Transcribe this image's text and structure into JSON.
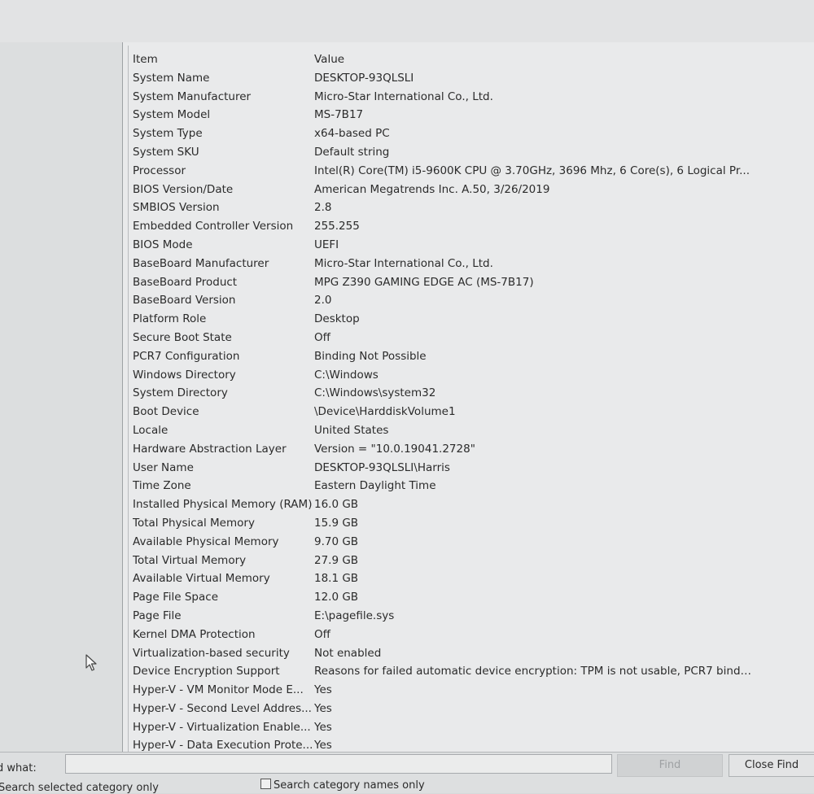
{
  "columns": {
    "item": "Item",
    "value": "Value"
  },
  "rows": [
    {
      "item": "System Name",
      "value": "DESKTOP-93QLSLI"
    },
    {
      "item": "System Manufacturer",
      "value": "Micro-Star International Co., Ltd."
    },
    {
      "item": "System Model",
      "value": "MS-7B17"
    },
    {
      "item": "System Type",
      "value": "x64-based PC"
    },
    {
      "item": "System SKU",
      "value": "Default string"
    },
    {
      "item": "Processor",
      "value": "Intel(R) Core(TM) i5-9600K CPU @ 3.70GHz, 3696 Mhz, 6 Core(s), 6 Logical Pr..."
    },
    {
      "item": "BIOS Version/Date",
      "value": "American Megatrends Inc. A.50, 3/26/2019"
    },
    {
      "item": "SMBIOS Version",
      "value": "2.8"
    },
    {
      "item": "Embedded Controller Version",
      "value": "255.255"
    },
    {
      "item": "BIOS Mode",
      "value": "UEFI"
    },
    {
      "item": "BaseBoard Manufacturer",
      "value": "Micro-Star International Co., Ltd."
    },
    {
      "item": "BaseBoard Product",
      "value": "MPG Z390 GAMING EDGE AC (MS-7B17)"
    },
    {
      "item": "BaseBoard Version",
      "value": "2.0"
    },
    {
      "item": "Platform Role",
      "value": "Desktop"
    },
    {
      "item": "Secure Boot State",
      "value": "Off"
    },
    {
      "item": "PCR7 Configuration",
      "value": "Binding Not Possible"
    },
    {
      "item": "Windows Directory",
      "value": "C:\\Windows"
    },
    {
      "item": "System Directory",
      "value": "C:\\Windows\\system32"
    },
    {
      "item": "Boot Device",
      "value": "\\Device\\HarddiskVolume1"
    },
    {
      "item": "Locale",
      "value": "United States"
    },
    {
      "item": "Hardware Abstraction Layer",
      "value": "Version = \"10.0.19041.2728\""
    },
    {
      "item": "User Name",
      "value": "DESKTOP-93QLSLI\\Harris"
    },
    {
      "item": "Time Zone",
      "value": "Eastern Daylight Time"
    },
    {
      "item": "Installed Physical Memory (RAM)",
      "value": "16.0 GB"
    },
    {
      "item": "Total Physical Memory",
      "value": "15.9 GB"
    },
    {
      "item": "Available Physical Memory",
      "value": "9.70 GB"
    },
    {
      "item": "Total Virtual Memory",
      "value": "27.9 GB"
    },
    {
      "item": "Available Virtual Memory",
      "value": "18.1 GB"
    },
    {
      "item": "Page File Space",
      "value": "12.0 GB"
    },
    {
      "item": "Page File",
      "value": "E:\\pagefile.sys"
    },
    {
      "item": "Kernel DMA Protection",
      "value": "Off"
    },
    {
      "item": "Virtualization-based security",
      "value": "Not enabled"
    },
    {
      "item": "Device Encryption Support",
      "value": "Reasons for failed automatic device encryption: TPM is not usable, PCR7 bindi..."
    },
    {
      "item": "Hyper-V - VM Monitor Mode E...",
      "value": "Yes"
    },
    {
      "item": "Hyper-V - Second Level Addres...",
      "value": "Yes"
    },
    {
      "item": "Hyper-V - Virtualization Enable...",
      "value": "Yes"
    },
    {
      "item": "Hyper-V - Data Execution Prote...",
      "value": "Yes"
    }
  ],
  "findbar": {
    "find_what_label": "d what:",
    "find_value": "",
    "find_button": "Find",
    "close_find_button": "Close Find",
    "search_selected_label": "Search selected category only",
    "search_names_label": "Search category names only"
  },
  "icons": {
    "cursor": "mouse-pointer-icon"
  }
}
